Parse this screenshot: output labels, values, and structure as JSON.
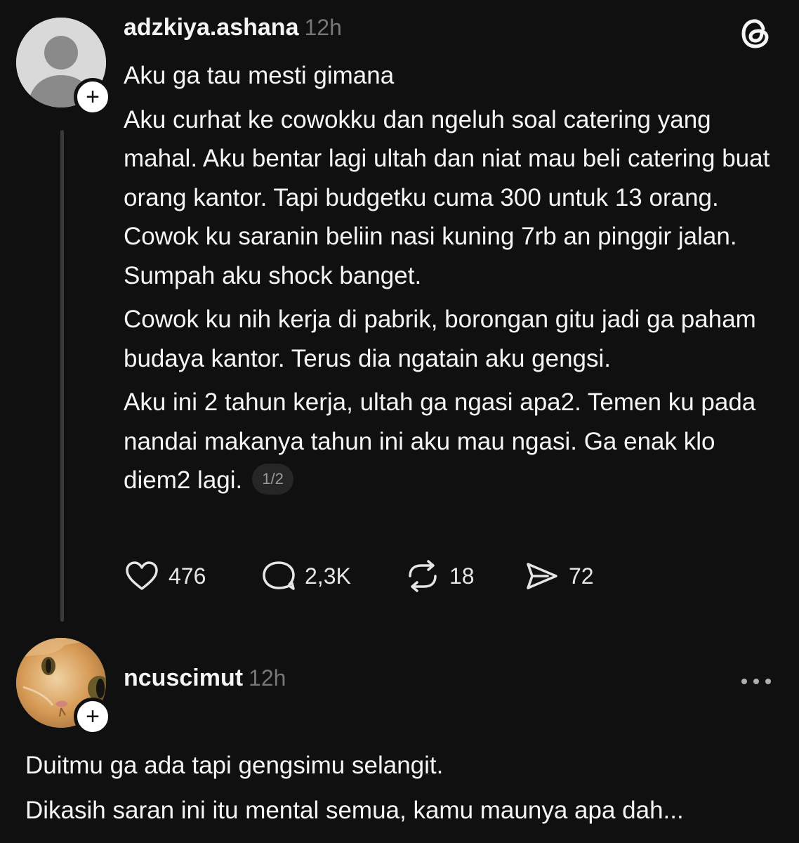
{
  "post": {
    "username": "adzkiya.ashana",
    "time": "12h",
    "paragraphs": [
      "Aku ga tau mesti gimana",
      "Aku curhat ke cowokku dan ngeluh soal catering yang mahal. Aku bentar lagi ultah dan niat mau beli catering buat orang kantor. Tapi budgetku cuma 300 untuk 13 orang. Cowok ku saranin beliin nasi kuning 7rb an pinggir jalan. Sumpah aku shock banget.",
      "Cowok ku nih kerja di pabrik, borongan gitu jadi ga paham budaya kantor. Terus dia ngatain aku gengsi.",
      "Aku ini 2 tahun kerja, ultah ga ngasi apa2. Temen ku pada nandai makanya tahun ini aku mau ngasi. Ga enak klo diem2 lagi."
    ],
    "pager": "1/2",
    "likes": "476",
    "replies": "2,3K",
    "reposts": "18",
    "shares": "72"
  },
  "reply": {
    "username": "ncuscimut",
    "time": "12h",
    "lines": [
      "Duitmu ga ada tapi gengsimu selangit.",
      "Dikasih saran ini itu mental semua, kamu maunya apa dah..."
    ]
  },
  "icons": {
    "app_logo": "threads-logo-icon",
    "more": "more-horizontal-icon",
    "like": "heart-icon",
    "reply": "comment-icon",
    "repost": "repost-icon",
    "share": "send-icon"
  }
}
